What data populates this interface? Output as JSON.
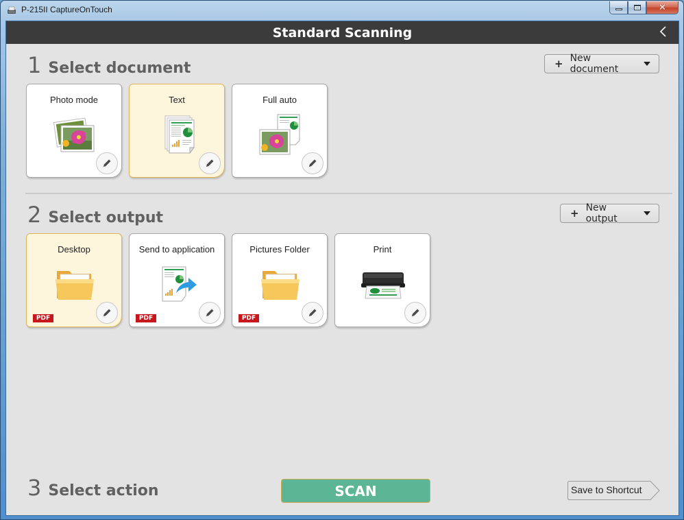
{
  "window": {
    "title": "P-215II CaptureOnTouch",
    "controls": {
      "minimize": "minimize",
      "maximize": "maximize",
      "close": "close"
    }
  },
  "header": {
    "title": "Standard Scanning",
    "back_icon": "chevron-left-icon"
  },
  "colors": {
    "header_bg": "#3b3b3b",
    "selected_card_bg": "#fdf5dc",
    "selected_card_border": "#e0b359",
    "scan_button": "#5cb595",
    "pdf_badge": "#c6171c"
  },
  "sections": {
    "document": {
      "number": "1",
      "label": "Select document",
      "new_button": "New document",
      "cards": [
        {
          "label": "Photo mode",
          "icon": "photo-icon",
          "selected": false
        },
        {
          "label": "Text",
          "icon": "text-document-icon",
          "selected": true
        },
        {
          "label": "Full auto",
          "icon": "full-auto-icon",
          "selected": false
        }
      ]
    },
    "output": {
      "number": "2",
      "label": "Select output",
      "new_button": "New output",
      "cards": [
        {
          "label": "Desktop",
          "icon": "folder-icon",
          "badge": "PDF",
          "selected": true
        },
        {
          "label": "Send to application",
          "icon": "send-to-app-icon",
          "badge": "PDF",
          "selected": false
        },
        {
          "label": "Pictures Folder",
          "icon": "folder-icon",
          "badge": "PDF",
          "selected": false
        },
        {
          "label": "Print",
          "icon": "printer-icon",
          "selected": false
        }
      ]
    },
    "action": {
      "number": "3",
      "label": "Select action",
      "scan_button": "SCAN",
      "shortcut_button": "Save to Shortcut"
    }
  }
}
